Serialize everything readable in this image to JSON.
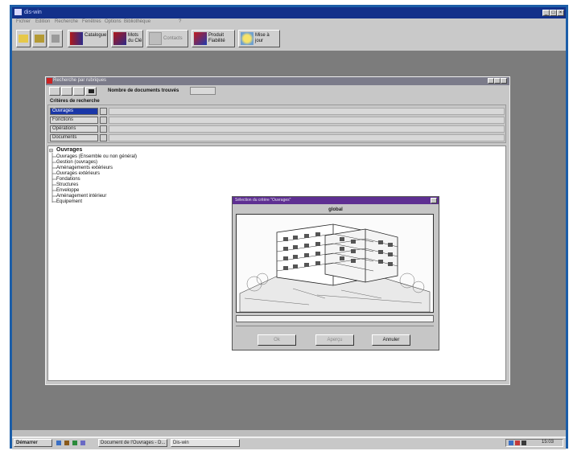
{
  "app": {
    "title": "dis-win"
  },
  "menu": [
    "Fichier",
    "Edition",
    "Recherche",
    "Fenêtres",
    "Options",
    "Bibliothèque",
    "?"
  ],
  "toolbar": {
    "catalogue": "Catalogue",
    "mots_cles": "Mots du Clé",
    "contacts": "Contacts",
    "produit": "Produit Fiabilité",
    "mise_a_jour": "Mise à jour"
  },
  "child_window": {
    "title": "Recherche par rubriques",
    "doc_count_label": "Nombre de documents trouvés",
    "doc_count_value": "",
    "criteria_label": "Critères de recherche",
    "criteria": [
      "Ouvrages",
      "Fonctions",
      "Opérations",
      "Documents"
    ]
  },
  "tree": {
    "root": "Ouvrages",
    "items": [
      "Ouvrages (Ensemble ou non général)",
      "Gestion (ouvrages)",
      "Aménagements extérieurs",
      "Ouvrages extérieurs",
      "Fondations",
      "Structures",
      "Enveloppe",
      "Aménagement intérieur",
      "Equipement"
    ]
  },
  "dialog": {
    "title": "Sélection du critère \"Ouvrages\"",
    "caption": "global",
    "ok": "Ok",
    "preview": "Aperçu",
    "cancel": "Annuler"
  },
  "taskbar": {
    "start": "Démarrer",
    "tasks": [
      "Document de l'Ouvrages - D...",
      "Dis-win"
    ],
    "clock": "15:03"
  },
  "colors": {
    "frame": "#1c5ea8",
    "titlebar": "#13318a",
    "dialog_title": "#5e2f92",
    "desktop": "#7c7c7c"
  }
}
